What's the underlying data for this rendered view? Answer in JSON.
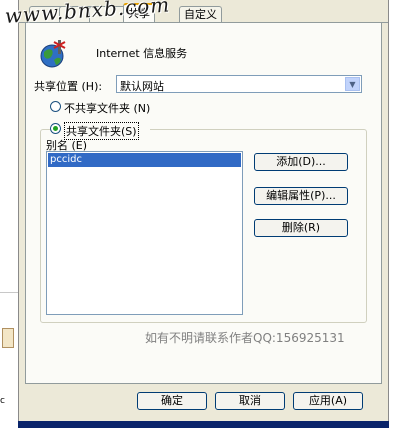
{
  "tabs": [
    "共享",
    "自定义"
  ],
  "service_name": "Internet 信息服务",
  "share_location": {
    "label": "共享位置",
    "hotkey": "(H):",
    "value": "默认网站"
  },
  "radios": [
    {
      "label": "不共享文件夹",
      "hotkey": "(N)",
      "checked": false
    },
    {
      "label": "共享文件夹",
      "hotkey": "(S)",
      "checked": true
    }
  ],
  "alias": {
    "label": "别名",
    "hotkey": "(E)",
    "items": [
      "pccidc"
    ]
  },
  "side_buttons": [
    "添加(D)...",
    "编辑属性(P)...",
    "删除(R)"
  ],
  "note": "如有不明请联系作者QQ:156925131",
  "footer_buttons": [
    "确定",
    "取消",
    "应用(A)"
  ],
  "watermark": "www.bnxb.com",
  "left_fragment": "c",
  "colors": {
    "accent_tab": "#e5a000",
    "selection": "#316ac5",
    "window_bg": "#ece9d8"
  }
}
